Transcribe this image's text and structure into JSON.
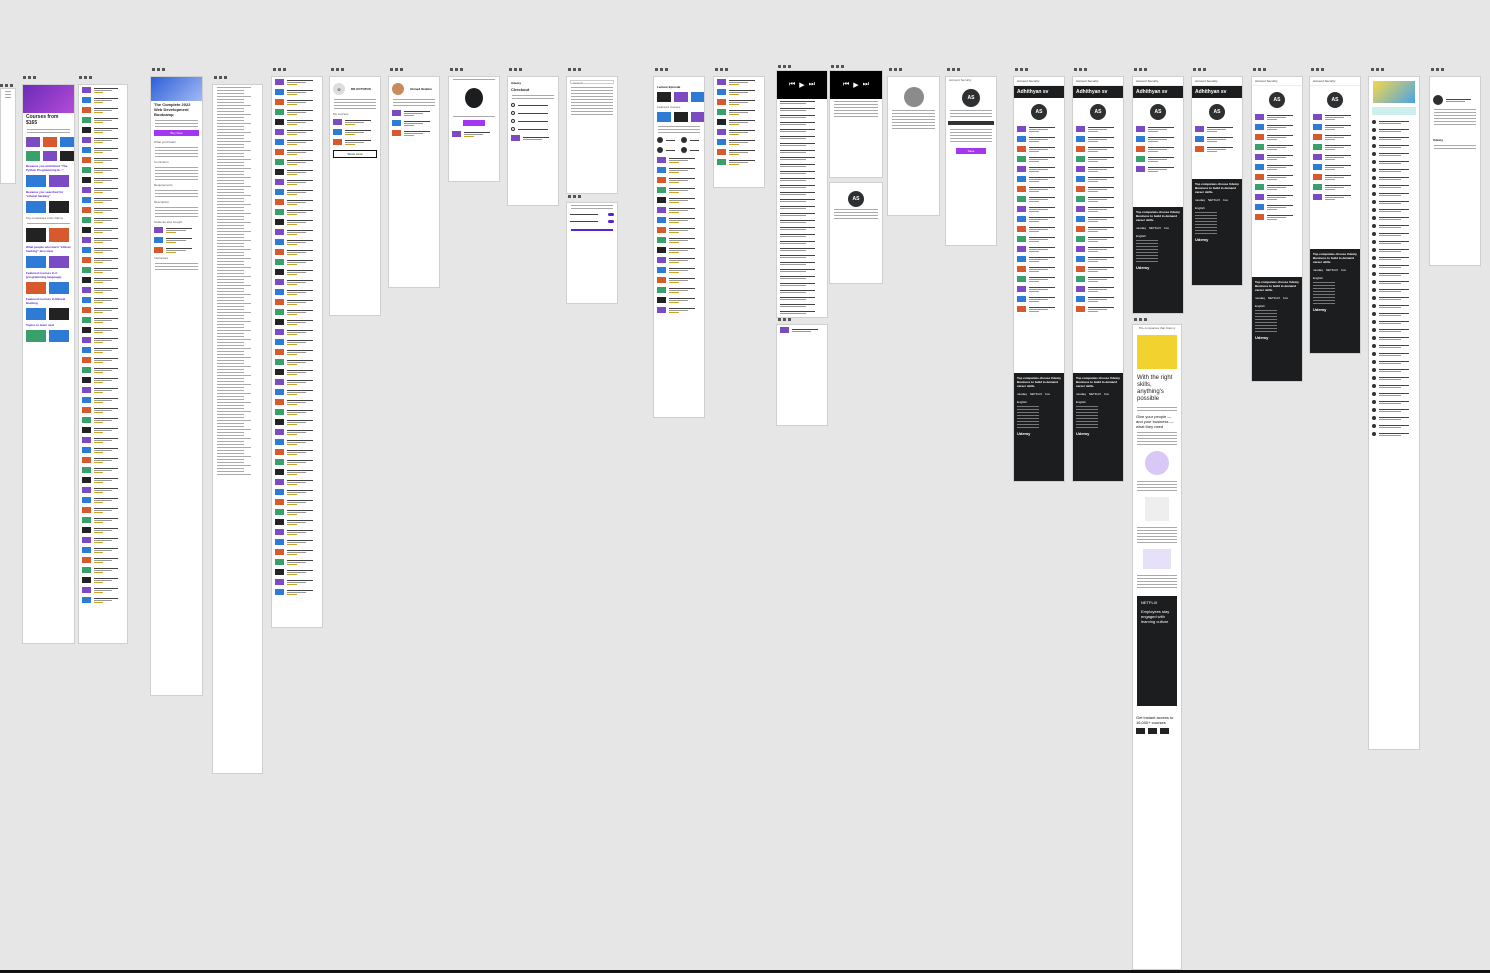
{
  "canvas": {
    "bottom_bar_color": "#111111"
  },
  "courses_home": {
    "title": "Courses from $165",
    "section_because_1": "Because you wishlisted \"The Python Programming B...\"",
    "section_because_2": "Because you searched for \"ethical hacking\"",
    "section_what_people": "What people who learn \"ethical hacking\" also view",
    "section_featured_c": "Featured courses in C (programming language)",
    "section_featured_hacking": "Featured courses in Ethical Hacking",
    "section_topics": "Topics to learn next",
    "section_top_companies": "Top companies trust Udemy"
  },
  "course_detail": {
    "title": "The Complete 2022 Web Development Bootcamp",
    "buy_label": "Buy Now",
    "section_learn": "What you'll learn",
    "section_curriculum": "Curriculum",
    "section_requirements": "Requirements",
    "section_description": "Description",
    "section_students_bought": "Students also bought",
    "section_instructors": "Instructors",
    "see_all": "See all",
    "show_more": "Show more"
  },
  "instructor": {
    "name": "DR OCTOPUS",
    "name2": "Ahmed Ibrahim",
    "my_courses": "My courses"
  },
  "checkout": {
    "title": "Checkout",
    "search_placeholder": "Search"
  },
  "my_learning": {
    "title": "Lecture Episode",
    "featured": "Featured courses"
  },
  "account": {
    "initials": "AS",
    "name": "Adhithyan sv",
    "account_security": "Account Security",
    "save_label": "Save",
    "logout": "Sign out"
  },
  "landing": {
    "headline": "With the right skills, anything's possible",
    "sub": "The companies that Udemy",
    "section_you_need": "Give your people — and your business — what they need",
    "quote": "Employees stay engaged with learning culture",
    "footer_title": "Get instant access to 16,000+ courses",
    "brands": [
      "nasdaq",
      "NETFLIX",
      "box",
      "eventbrite",
      "Udemy"
    ]
  },
  "dark_footer": {
    "brand": "Udemy",
    "tagline": "Top companies choose Udemy Business to build in-demand career skills.",
    "lang": "English"
  },
  "colors": {
    "brand_purple": "#a435f0",
    "dark": "#1c1d1f",
    "accent_yellow": "#f2d22f"
  }
}
